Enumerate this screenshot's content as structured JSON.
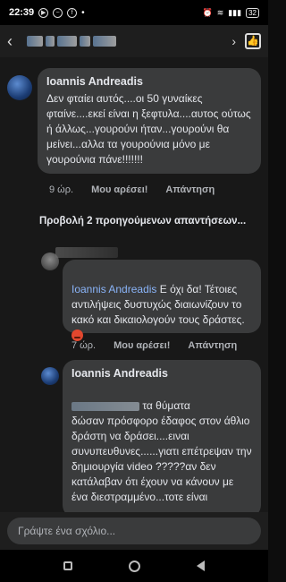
{
  "status": {
    "time": "22:39",
    "battery": "32"
  },
  "comment1": {
    "author": "Ioannis Andreadis",
    "text": "Δεν φταίει αυτός....οι 50 γυναίκες φταίνε....εκεί είναι η ξεφτυλα....αυτος ούτως ή άλλως...γουρούνι ήταν...γουρούνι θα μείνει...αλλα τα γουρούνια μόνο με γουρούνια πάνε!!!!!!!",
    "time": "9 ώρ.",
    "like": "Μου αρέσει!",
    "reply": "Απάντηση"
  },
  "more_replies": "Προβολή 2 προηγούμενων απαντήσεων...",
  "comment2": {
    "mention": "Ioannis Andreadis",
    "text": " Ε όχι  δα! Τέτοιες αντιλήψεις δυστυχώς διαιωνίζουν το κακό και δικαιολογούν τους δράστες. ",
    "time": "7 ώρ.",
    "like": "Μου αρέσει!",
    "reply": "Απάντηση"
  },
  "comment3": {
    "author": "Ioannis Andreadis",
    "text_suffix": " τα θύματα",
    "text": "δώσαν πρόσφορο έδαφος στον άθλιο δράστη να δράσει....ειναι συνυπευθυνες......γιατι επέτρεψαν την δημιουργία video ?????αν δεν κατάλαβαν ότι έχουν να κάνουν με ένα διεστραμμένο...τοτε είναι"
  },
  "composer": {
    "placeholder": "Γράψτε ένα σχόλιο..."
  }
}
